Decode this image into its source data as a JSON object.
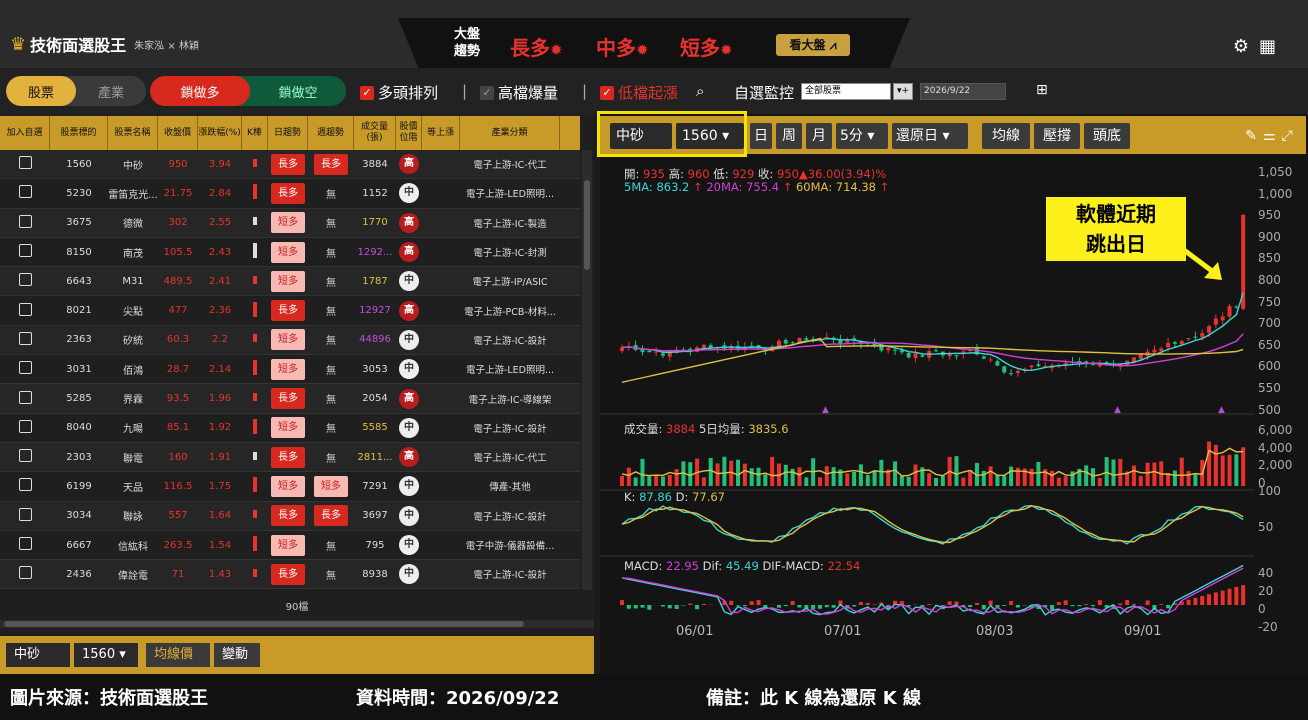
{
  "app": {
    "title": "技術面選股王",
    "authors": "朱家泓 × 林穎"
  },
  "market": {
    "label": "大盤趨勢",
    "long": "長多",
    "mid": "中多",
    "short": "短多",
    "view_button": "看大盤"
  },
  "icons": {
    "settings": "gear-icon",
    "apps": "grid-icon",
    "search": "search-icon",
    "layout": "table-icon",
    "draw": "pencil-icon",
    "tools": "sliders-icon",
    "expand": "expand-icon"
  },
  "toolbar": {
    "tab_stocks": "股票",
    "tab_industry": "產業",
    "lock_long": "鎖做多",
    "lock_short": "鎖做空",
    "multi_head": "多頭排列",
    "high_volume": "高檔爆量",
    "low_rise": "低檔起漲",
    "watchlist": "自選監控",
    "watch_select": "全部股票",
    "date": "2026/9/22"
  },
  "table": {
    "headers": [
      "加入自選",
      "股票標的",
      "股票名稱",
      "收盤價",
      "漲跌幅(%)",
      "K棒",
      "日趨勢",
      "週趨勢",
      "成交量(張)",
      "股價位階",
      "等上漲",
      "產業分類"
    ],
    "rows": [
      {
        "code": "1560",
        "name": "中砂",
        "close": "950",
        "chg": "3.94",
        "day": "長多",
        "week": "長多",
        "vol": "3884",
        "pos": "高",
        "ind": "電子上游-IC-代工"
      },
      {
        "code": "5230",
        "name": "雷笛克光...",
        "close": "21.75",
        "chg": "2.84",
        "day": "長多",
        "week": "無",
        "vol": "1152",
        "pos": "中",
        "ind": "電子上游-LED照明..."
      },
      {
        "code": "3675",
        "name": "德微",
        "close": "302",
        "chg": "2.55",
        "day": "短多",
        "week": "無",
        "vol": "1770",
        "pos": "高",
        "ind": "電子上游-IC-製造"
      },
      {
        "code": "8150",
        "name": "南茂",
        "close": "105.5",
        "chg": "2.43",
        "day": "短多",
        "week": "無",
        "vol": "1292...",
        "pos": "高",
        "ind": "電子上游-IC-封測"
      },
      {
        "code": "6643",
        "name": "M31",
        "close": "489.5",
        "chg": "2.41",
        "day": "短多",
        "week": "無",
        "vol": "1787",
        "pos": "中",
        "ind": "電子上游-IP/ASIC"
      },
      {
        "code": "8021",
        "name": "尖點",
        "close": "477",
        "chg": "2.36",
        "day": "長多",
        "week": "無",
        "vol": "12927",
        "pos": "高",
        "ind": "電子上游-PCB-材料..."
      },
      {
        "code": "2363",
        "name": "矽統",
        "close": "60.3",
        "chg": "2.2",
        "day": "短多",
        "week": "無",
        "vol": "44896",
        "pos": "中",
        "ind": "電子上游-IC-設計"
      },
      {
        "code": "3031",
        "name": "佰鴻",
        "close": "28.7",
        "chg": "2.14",
        "day": "短多",
        "week": "無",
        "vol": "3053",
        "pos": "中",
        "ind": "電子上游-LED照明..."
      },
      {
        "code": "5285",
        "name": "界霖",
        "close": "93.5",
        "chg": "1.96",
        "day": "長多",
        "week": "無",
        "vol": "2054",
        "pos": "高",
        "ind": "電子上游-IC-導線架"
      },
      {
        "code": "8040",
        "name": "九暘",
        "close": "85.1",
        "chg": "1.92",
        "day": "短多",
        "week": "無",
        "vol": "5585",
        "pos": "中",
        "ind": "電子上游-IC-設計"
      },
      {
        "code": "2303",
        "name": "聯電",
        "close": "160",
        "chg": "1.91",
        "day": "長多",
        "week": "無",
        "vol": "2811...",
        "pos": "高",
        "ind": "電子上游-IC-代工"
      },
      {
        "code": "6199",
        "name": "天品",
        "close": "116.5",
        "chg": "1.75",
        "day": "短多",
        "week": "短多",
        "vol": "7291",
        "pos": "中",
        "ind": "傳產-其他"
      },
      {
        "code": "3034",
        "name": "聯詠",
        "close": "557",
        "chg": "1.64",
        "day": "長多",
        "week": "長多",
        "vol": "3697",
        "pos": "中",
        "ind": "電子上游-IC-設計"
      },
      {
        "code": "6667",
        "name": "信紘科",
        "close": "263.5",
        "chg": "1.54",
        "day": "短多",
        "week": "無",
        "vol": "795",
        "pos": "中",
        "ind": "電子中游-儀器設備..."
      },
      {
        "code": "2436",
        "name": "偉詮電",
        "close": "71",
        "chg": "1.43",
        "day": "長多",
        "week": "無",
        "vol": "8938",
        "pos": "中",
        "ind": "電子上游-IC-設計"
      }
    ],
    "count": "90檔"
  },
  "bottom": {
    "name": "中砂",
    "code": "1560",
    "ma_price": "均線價",
    "change": "變動"
  },
  "chart_toolbar": {
    "name": "中砂",
    "code": "1560",
    "periods": [
      "日",
      "周",
      "月"
    ],
    "interval": "5分",
    "adjust": "還原日",
    "buttons": [
      "均線",
      "壓撐",
      "頭底"
    ]
  },
  "ohlc": {
    "open_label": "開:",
    "open": "935",
    "high_label": "高:",
    "high": "960",
    "low_label": "低:",
    "low": "929",
    "close_label": "收:",
    "close": "950",
    "change": "▲36.00(3.94)%"
  },
  "ma": {
    "ma5_label": "5MA:",
    "ma5": "863.2",
    "ma20_label": "20MA:",
    "ma20": "755.4",
    "ma60_label": "60MA:",
    "ma60": "714.38"
  },
  "vol": {
    "label": "成交量:",
    "value": "3884",
    "avg_label": "5日均量:",
    "avg": "3835.6"
  },
  "kd": {
    "k_label": "K:",
    "k": "87.86",
    "d_label": "D:",
    "d": "77.67"
  },
  "macd": {
    "label": "MACD:",
    "value": "22.95",
    "dif_label": "Dif:",
    "dif": "45.49",
    "osc_label": "DIF-MACD:",
    "osc": "22.54"
  },
  "axes": {
    "price": [
      "1,050",
      "1,000",
      "950",
      "900",
      "850",
      "800",
      "750",
      "700",
      "650",
      "600",
      "550",
      "500"
    ],
    "volume": [
      "6,000",
      "4,000",
      "2,000",
      "0"
    ],
    "kd": [
      "100",
      "50"
    ],
    "macd": [
      "40",
      "20",
      "0",
      "-20"
    ],
    "x": [
      "06/01",
      "07/01",
      "08/03",
      "09/01"
    ]
  },
  "callout": {
    "line1": "軟體近期",
    "line2": "跳出日"
  },
  "footer": {
    "source": "圖片來源：技術面選股王",
    "time": "資料時間：2026/09/22",
    "note": "備註：此 K 線為還原 K 線"
  },
  "colors": {
    "gold": "#c89a28",
    "up": "#e8322e",
    "down": "#21c07a",
    "ma5": "#3ad6d6",
    "ma20": "#d040d8",
    "ma60": "#e0c040"
  }
}
